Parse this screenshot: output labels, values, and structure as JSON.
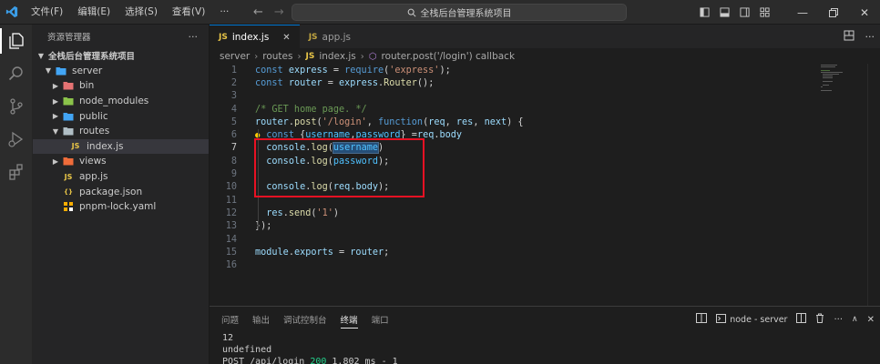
{
  "titlebar": {
    "menu": [
      "文件(F)",
      "编辑(E)",
      "选择(S)",
      "查看(V)",
      "···"
    ],
    "search_text": "全栈后台管理系统项目"
  },
  "explorer": {
    "header": "资源管理器",
    "more": "···",
    "root": "全栈后台管理系统项目",
    "items": [
      {
        "label": "server",
        "depth": 1,
        "chevron": "open",
        "icon": "folder-icon"
      },
      {
        "label": "bin",
        "depth": 2,
        "chevron": "closed",
        "icon": "folder-icon"
      },
      {
        "label": "node_modules",
        "depth": 2,
        "chevron": "closed",
        "icon": "folder-icon"
      },
      {
        "label": "public",
        "depth": 2,
        "chevron": "closed",
        "icon": "folder-icon"
      },
      {
        "label": "routes",
        "depth": 2,
        "chevron": "open",
        "icon": "folder-icon"
      },
      {
        "label": "index.js",
        "depth": 3,
        "chevron": "none",
        "icon": "js-icon"
      },
      {
        "label": "views",
        "depth": 2,
        "chevron": "closed",
        "icon": "folder-icon"
      },
      {
        "label": "app.js",
        "depth": 2,
        "chevron": "none",
        "icon": "js-icon"
      },
      {
        "label": "package.json",
        "depth": 2,
        "chevron": "none",
        "icon": "json-icon"
      },
      {
        "label": "pnpm-lock.yaml",
        "depth": 2,
        "chevron": "none",
        "icon": "yaml-icon"
      }
    ]
  },
  "tabs": [
    {
      "badge": "JS",
      "label": "index.js",
      "active": true,
      "close": "✕"
    },
    {
      "badge": "JS",
      "label": "app.js",
      "active": false
    }
  ],
  "breadcrumb": [
    "server",
    "routes",
    "index.js",
    "router.post('/login') callback"
  ],
  "code_lines": [
    {
      "n": "1",
      "text": "const express = require('express');"
    },
    {
      "n": "2",
      "text": "const router = express.Router();"
    },
    {
      "n": "3",
      "text": ""
    },
    {
      "n": "4",
      "text": "/* GET home page. */"
    },
    {
      "n": "5",
      "text": "router.post('/login', function(req, res, next) {"
    },
    {
      "n": "6",
      "text": "  const {username,password} =req.body"
    },
    {
      "n": "7",
      "text": "  console.log(username)"
    },
    {
      "n": "8",
      "text": "  console.log(password);"
    },
    {
      "n": "9",
      "text": ""
    },
    {
      "n": "10",
      "text": "  console.log(req.body);"
    },
    {
      "n": "11",
      "text": ""
    },
    {
      "n": "12",
      "text": "  res.send('1')"
    },
    {
      "n": "13",
      "text": "});"
    },
    {
      "n": "14",
      "text": ""
    },
    {
      "n": "15",
      "text": "module.exports = router;"
    },
    {
      "n": "16",
      "text": ""
    }
  ],
  "panel": {
    "tabs": [
      "问题",
      "输出",
      "调试控制台",
      "终端",
      "端口"
    ],
    "active_tab": "终端",
    "terminal_name": "node - server",
    "terminal_lines": [
      "12",
      "undefined"
    ],
    "request_line": {
      "prefix": "POST /api/login ",
      "status": "200",
      "suffix": " 1.802 ms - 1"
    }
  },
  "colors": {
    "accent": "#0078d4",
    "highlight_box": "#e81123"
  }
}
